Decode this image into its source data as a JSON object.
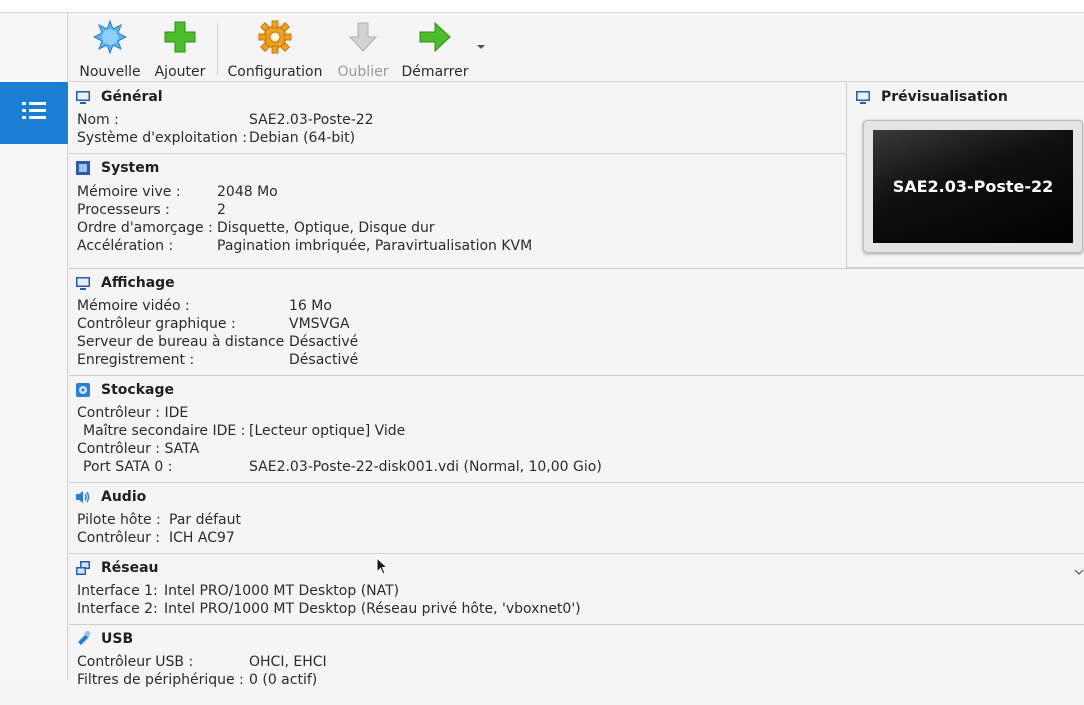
{
  "toolbar": {
    "new_label": "Nouvelle",
    "add_label": "Ajouter",
    "settings_label": "Configuration",
    "discard_label": "Oublier",
    "start_label": "Démarrer"
  },
  "sections": {
    "general": {
      "title": "Général",
      "rows": [
        {
          "key": "Nom :",
          "value": "SAE2.03-Poste-22"
        },
        {
          "key": "Système d'exploitation :",
          "value": "Debian (64-bit)"
        }
      ]
    },
    "system": {
      "title": "System",
      "rows": [
        {
          "key": "Mémoire vive :",
          "value": "2048 Mo"
        },
        {
          "key": "Processeurs :",
          "value": "2"
        },
        {
          "key": "Ordre d'amorçage :",
          "value": "Disquette, Optique, Disque dur"
        },
        {
          "key": "Accélération :",
          "value": "Pagination imbriquée, Paravirtualisation KVM"
        }
      ]
    },
    "display": {
      "title": "Affichage",
      "rows": [
        {
          "key": "Mémoire vidéo :",
          "value": "16 Mo"
        },
        {
          "key": "Contrôleur graphique :",
          "value": "VMSVGA"
        },
        {
          "key": "Serveur de bureau à distance :",
          "value": "Désactivé"
        },
        {
          "key": "Enregistrement :",
          "value": "Désactivé"
        }
      ]
    },
    "storage": {
      "title": "Stockage",
      "rows": [
        {
          "key": "Contrôleur : IDE",
          "value": ""
        },
        {
          "key": " Maître secondaire IDE :",
          "value": "[Lecteur optique] Vide"
        },
        {
          "key": "Contrôleur : SATA",
          "value": ""
        },
        {
          "key": " Port SATA 0 :",
          "value": "SAE2.03-Poste-22-disk001.vdi (Normal, 10,00 Gio)"
        }
      ]
    },
    "audio": {
      "title": "Audio",
      "rows": [
        {
          "key": "Pilote hôte :",
          "value": "Par défaut"
        },
        {
          "key": "Contrôleur :",
          "value": "ICH AC97"
        }
      ]
    },
    "network": {
      "title": "Réseau",
      "rows": [
        {
          "key": "Interface 1:",
          "value": "Intel PRO/1000 MT Desktop (NAT)"
        },
        {
          "key": "Interface 2:",
          "value": "Intel PRO/1000 MT Desktop (Réseau privé hôte, 'vboxnet0')"
        }
      ]
    },
    "usb": {
      "title": "USB",
      "rows": [
        {
          "key": "Contrôleur USB :",
          "value": "OHCI, EHCI"
        },
        {
          "key": "Filtres de périphérique :",
          "value": "0 (0 actif)"
        }
      ]
    }
  },
  "preview": {
    "title": "Prévisualisation",
    "screen_text": "SAE2.03-Poste-22"
  },
  "colors": {
    "selection_blue": "#1a7fd4",
    "start_green": "#4caf1a",
    "add_green": "#3fa32a",
    "gear_orange": "#f0a020"
  }
}
